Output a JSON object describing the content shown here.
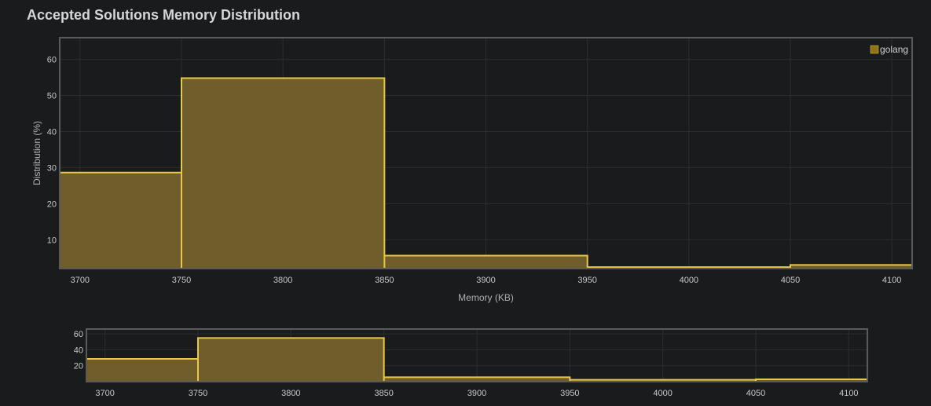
{
  "title": "Accepted Solutions Memory Distribution",
  "chart_data": {
    "type": "bar",
    "subtype": "histogram",
    "bins": [
      {
        "start": 3690,
        "end": 3750,
        "value": 28.6
      },
      {
        "start": 3750,
        "end": 3850,
        "value": 54.8
      },
      {
        "start": 3850,
        "end": 3950,
        "value": 5.6
      },
      {
        "start": 3950,
        "end": 4050,
        "value": 2.4
      },
      {
        "start": 4050,
        "end": 4110,
        "value": 3.0
      }
    ],
    "series": [
      {
        "name": "golang"
      }
    ],
    "xlabel": "Memory (KB)",
    "ylabel": "Distribution (%)",
    "xlim": [
      3690,
      4110
    ],
    "ylim": [
      2,
      66
    ],
    "xticks": [
      3700,
      3750,
      3800,
      3850,
      3900,
      3950,
      4000,
      4050,
      4100
    ],
    "yticks": [
      10,
      20,
      30,
      40,
      50,
      60
    ],
    "grid": true,
    "legend_position": "top-right",
    "navigator": {
      "ylim": [
        0,
        66
      ],
      "yticks": [
        20,
        40,
        60
      ],
      "xticks": [
        3700,
        3750,
        3800,
        3850,
        3900,
        3950,
        4000,
        4050,
        4100
      ]
    },
    "colors": {
      "bar_fill": "#6f5e2c",
      "bar_stroke": "#e9c846",
      "legend_swatch": "#8f7414",
      "grid": "#2c2d30",
      "frame": "#5a5a5a"
    }
  }
}
